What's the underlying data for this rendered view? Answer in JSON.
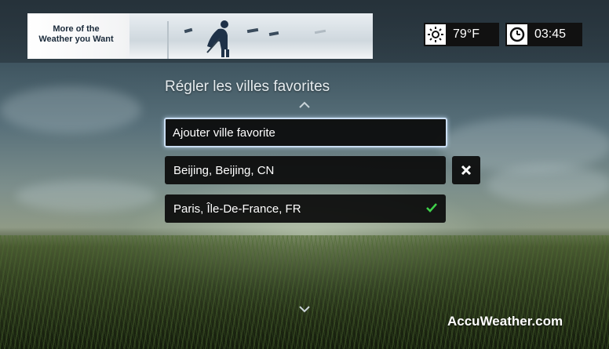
{
  "ad": {
    "line1": "More of the",
    "line2": "Weather you Want"
  },
  "status": {
    "temperature": "79°F",
    "time": "03:45",
    "weather_icon": "sun-icon",
    "clock_icon": "clock-icon"
  },
  "screen_title": "Régler les villes favorites",
  "cities": {
    "add_label": "Ajouter ville favorite",
    "items": [
      {
        "label": "Beijing, Beijing, CN"
      },
      {
        "label": "Paris, Île-De-France, FR"
      }
    ]
  },
  "icons": {
    "scroll_up": "chevron-up-icon",
    "scroll_down": "chevron-down-icon",
    "delete": "close-icon",
    "default_city": "check-icon"
  },
  "colors": {
    "check": "#3fd14a",
    "selection_border": "#c9ddf2"
  },
  "brand": "AccuWeather.com"
}
